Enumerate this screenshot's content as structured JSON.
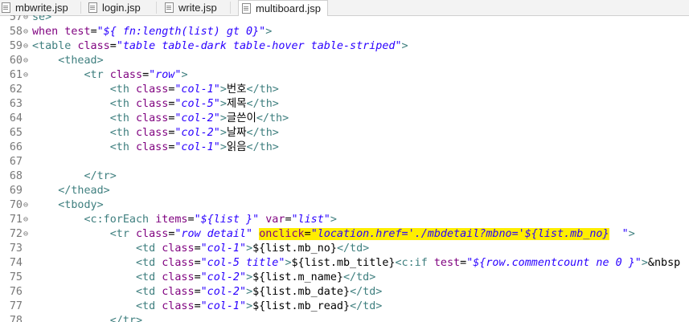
{
  "tabs": [
    {
      "label": "mbwrite.jsp"
    },
    {
      "label": "login.jsp"
    },
    {
      "label": "write.jsp"
    },
    {
      "label": "multiboard.jsp"
    }
  ],
  "lines": [
    {
      "num": "57",
      "fold": "⊖",
      "segs": [
        {
          "c": "tag",
          "t": "se>"
        }
      ]
    },
    {
      "num": "58",
      "fold": "⊖",
      "segs": [
        {
          "c": "attr",
          "t": "when test"
        },
        {
          "c": "txt",
          "t": "="
        },
        {
          "c": "val",
          "t": "\"${ fn:length(list) gt 0}\""
        },
        {
          "c": "tag",
          "t": ">"
        }
      ]
    },
    {
      "num": "59",
      "fold": "⊖",
      "segs": [
        {
          "c": "tag",
          "t": "<table "
        },
        {
          "c": "attr",
          "t": "class"
        },
        {
          "c": "txt",
          "t": "="
        },
        {
          "c": "val",
          "t": "\"table table-dark table-hover table-striped\""
        },
        {
          "c": "tag",
          "t": ">"
        }
      ]
    },
    {
      "num": "60",
      "fold": "⊖",
      "segs": [
        {
          "c": "txt",
          "t": "    "
        },
        {
          "c": "tag",
          "t": "<thead>"
        }
      ]
    },
    {
      "num": "61",
      "fold": "⊖",
      "segs": [
        {
          "c": "txt",
          "t": "        "
        },
        {
          "c": "tag",
          "t": "<tr "
        },
        {
          "c": "attr",
          "t": "class"
        },
        {
          "c": "txt",
          "t": "="
        },
        {
          "c": "val",
          "t": "\"row\""
        },
        {
          "c": "tag",
          "t": ">"
        }
      ]
    },
    {
      "num": "62",
      "fold": "",
      "segs": [
        {
          "c": "txt",
          "t": "            "
        },
        {
          "c": "tag",
          "t": "<th "
        },
        {
          "c": "attr",
          "t": "class"
        },
        {
          "c": "txt",
          "t": "="
        },
        {
          "c": "val",
          "t": "\"col-1\""
        },
        {
          "c": "tag",
          "t": ">"
        },
        {
          "c": "txt",
          "t": "번호"
        },
        {
          "c": "tag",
          "t": "</th>"
        }
      ]
    },
    {
      "num": "63",
      "fold": "",
      "segs": [
        {
          "c": "txt",
          "t": "            "
        },
        {
          "c": "tag",
          "t": "<th "
        },
        {
          "c": "attr",
          "t": "class"
        },
        {
          "c": "txt",
          "t": "="
        },
        {
          "c": "val",
          "t": "\"col-5\""
        },
        {
          "c": "tag",
          "t": ">"
        },
        {
          "c": "txt",
          "t": "제목"
        },
        {
          "c": "tag",
          "t": "</th>"
        }
      ]
    },
    {
      "num": "64",
      "fold": "",
      "segs": [
        {
          "c": "txt",
          "t": "            "
        },
        {
          "c": "tag",
          "t": "<th "
        },
        {
          "c": "attr",
          "t": "class"
        },
        {
          "c": "txt",
          "t": "="
        },
        {
          "c": "val",
          "t": "\"col-2\""
        },
        {
          "c": "tag",
          "t": ">"
        },
        {
          "c": "txt",
          "t": "글쓴이"
        },
        {
          "c": "tag",
          "t": "</th>"
        }
      ]
    },
    {
      "num": "65",
      "fold": "",
      "segs": [
        {
          "c": "txt",
          "t": "            "
        },
        {
          "c": "tag",
          "t": "<th "
        },
        {
          "c": "attr",
          "t": "class"
        },
        {
          "c": "txt",
          "t": "="
        },
        {
          "c": "val",
          "t": "\"col-2\""
        },
        {
          "c": "tag",
          "t": ">"
        },
        {
          "c": "txt",
          "t": "날짜"
        },
        {
          "c": "tag",
          "t": "</th>"
        }
      ]
    },
    {
      "num": "66",
      "fold": "",
      "segs": [
        {
          "c": "txt",
          "t": "            "
        },
        {
          "c": "tag",
          "t": "<th "
        },
        {
          "c": "attr",
          "t": "class"
        },
        {
          "c": "txt",
          "t": "="
        },
        {
          "c": "val",
          "t": "\"col-1\""
        },
        {
          "c": "tag",
          "t": ">"
        },
        {
          "c": "txt",
          "t": "읽음"
        },
        {
          "c": "tag",
          "t": "</th>"
        }
      ]
    },
    {
      "num": "67",
      "fold": "",
      "segs": []
    },
    {
      "num": "68",
      "fold": "",
      "segs": [
        {
          "c": "txt",
          "t": "        "
        },
        {
          "c": "tag",
          "t": "</tr>"
        }
      ]
    },
    {
      "num": "69",
      "fold": "",
      "segs": [
        {
          "c": "txt",
          "t": "    "
        },
        {
          "c": "tag",
          "t": "</thead>"
        }
      ]
    },
    {
      "num": "70",
      "fold": "⊖",
      "segs": [
        {
          "c": "txt",
          "t": "    "
        },
        {
          "c": "tag",
          "t": "<tbody>"
        }
      ]
    },
    {
      "num": "71",
      "fold": "⊖",
      "segs": [
        {
          "c": "txt",
          "t": "        "
        },
        {
          "c": "tag",
          "t": "<c:forEach "
        },
        {
          "c": "attr",
          "t": "items"
        },
        {
          "c": "txt",
          "t": "="
        },
        {
          "c": "val",
          "t": "\"${list }\""
        },
        {
          "c": "txt",
          "t": " "
        },
        {
          "c": "attr",
          "t": "var"
        },
        {
          "c": "txt",
          "t": "="
        },
        {
          "c": "val",
          "t": "\"list\""
        },
        {
          "c": "tag",
          "t": ">"
        }
      ]
    },
    {
      "num": "72",
      "fold": "⊖",
      "segs": [
        {
          "c": "txt",
          "t": "            "
        },
        {
          "c": "tag",
          "t": "<tr "
        },
        {
          "c": "attr",
          "t": "class"
        },
        {
          "c": "txt",
          "t": "="
        },
        {
          "c": "val",
          "t": "\"row detail\""
        },
        {
          "c": "txt",
          "t": " "
        },
        {
          "c": "attr hl",
          "t": "onclick"
        },
        {
          "c": "txt hl",
          "t": "="
        },
        {
          "c": "val hl",
          "t": "\"location.href='./mbdetail?mbno='${list.mb_no}"
        },
        {
          "c": "val",
          "t": "  \""
        },
        {
          "c": "tag",
          "t": ">"
        }
      ]
    },
    {
      "num": "73",
      "fold": "",
      "segs": [
        {
          "c": "txt",
          "t": "                "
        },
        {
          "c": "tag",
          "t": "<td "
        },
        {
          "c": "attr",
          "t": "class"
        },
        {
          "c": "txt",
          "t": "="
        },
        {
          "c": "val",
          "t": "\"col-1\""
        },
        {
          "c": "tag",
          "t": ">"
        },
        {
          "c": "txt",
          "t": "${list.mb_no}"
        },
        {
          "c": "tag",
          "t": "</td>"
        }
      ]
    },
    {
      "num": "74",
      "fold": "",
      "segs": [
        {
          "c": "txt",
          "t": "                "
        },
        {
          "c": "tag",
          "t": "<td "
        },
        {
          "c": "attr",
          "t": "class"
        },
        {
          "c": "txt",
          "t": "="
        },
        {
          "c": "val",
          "t": "\"col-5 title\""
        },
        {
          "c": "tag",
          "t": ">"
        },
        {
          "c": "txt",
          "t": "${list.mb_title}"
        },
        {
          "c": "tag",
          "t": "<c:if "
        },
        {
          "c": "attr",
          "t": "test"
        },
        {
          "c": "txt",
          "t": "="
        },
        {
          "c": "val",
          "t": "\"${row.commentcount ne 0 }\""
        },
        {
          "c": "tag",
          "t": ">"
        },
        {
          "c": "txt",
          "t": "&nbsp"
        }
      ]
    },
    {
      "num": "75",
      "fold": "",
      "segs": [
        {
          "c": "txt",
          "t": "                "
        },
        {
          "c": "tag",
          "t": "<td "
        },
        {
          "c": "attr",
          "t": "class"
        },
        {
          "c": "txt",
          "t": "="
        },
        {
          "c": "val",
          "t": "\"col-2\""
        },
        {
          "c": "tag",
          "t": ">"
        },
        {
          "c": "txt",
          "t": "${list.m_name}"
        },
        {
          "c": "tag",
          "t": "</td>"
        }
      ]
    },
    {
      "num": "76",
      "fold": "",
      "segs": [
        {
          "c": "txt",
          "t": "                "
        },
        {
          "c": "tag",
          "t": "<td "
        },
        {
          "c": "attr",
          "t": "class"
        },
        {
          "c": "txt",
          "t": "="
        },
        {
          "c": "val",
          "t": "\"col-2\""
        },
        {
          "c": "tag",
          "t": ">"
        },
        {
          "c": "txt",
          "t": "${list.mb_date}"
        },
        {
          "c": "tag",
          "t": "</td>"
        }
      ]
    },
    {
      "num": "77",
      "fold": "",
      "segs": [
        {
          "c": "txt",
          "t": "                "
        },
        {
          "c": "tag",
          "t": "<td "
        },
        {
          "c": "attr",
          "t": "class"
        },
        {
          "c": "txt",
          "t": "="
        },
        {
          "c": "val",
          "t": "\"col-1\""
        },
        {
          "c": "tag",
          "t": ">"
        },
        {
          "c": "txt",
          "t": "${list.mb_read}"
        },
        {
          "c": "tag",
          "t": "</td>"
        }
      ]
    },
    {
      "num": "78",
      "fold": "",
      "segs": [
        {
          "c": "txt",
          "t": "            "
        },
        {
          "c": "tag",
          "t": "</tr>"
        }
      ]
    }
  ]
}
